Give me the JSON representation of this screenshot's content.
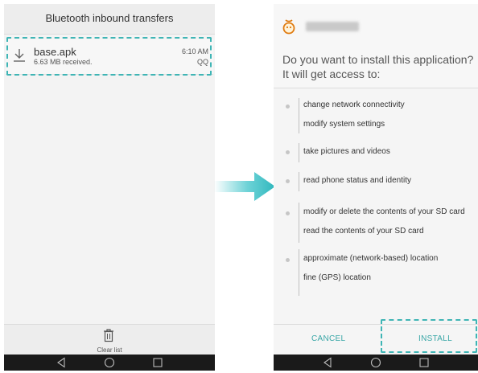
{
  "left_screen": {
    "title": "Bluetooth inbound transfers",
    "transfer": {
      "file_name": "base.apk",
      "status": "6.63 MB received.",
      "time": "6:10 AM",
      "source": "QQ",
      "icon": "download-icon"
    },
    "footer": {
      "clear_label": "Clear list",
      "icon": "trash-icon"
    }
  },
  "right_screen": {
    "app_icon": "app-logo-icon",
    "question": "Do you want to install this application? It will get access to:",
    "permissions": [
      {
        "items": [
          "change network connectivity",
          "modify system settings"
        ]
      },
      {
        "items": [
          "take pictures and videos"
        ]
      },
      {
        "items": [
          "read phone status and identity"
        ]
      },
      {
        "items": [
          "modify or delete the contents of your SD card",
          "read the contents of your SD card"
        ]
      },
      {
        "items": [
          "approximate (network-based) location",
          "fine (GPS) location"
        ]
      }
    ],
    "buttons": {
      "cancel": "CANCEL",
      "install": "INSTALL"
    }
  },
  "colors": {
    "accent": "#3aa7a7",
    "dashed_highlight": "#3fb5b5",
    "arrow": "#3cc3c9",
    "navbar": "#1a1a1a"
  },
  "navbar_icons": [
    "back-icon",
    "home-icon",
    "recents-icon"
  ]
}
